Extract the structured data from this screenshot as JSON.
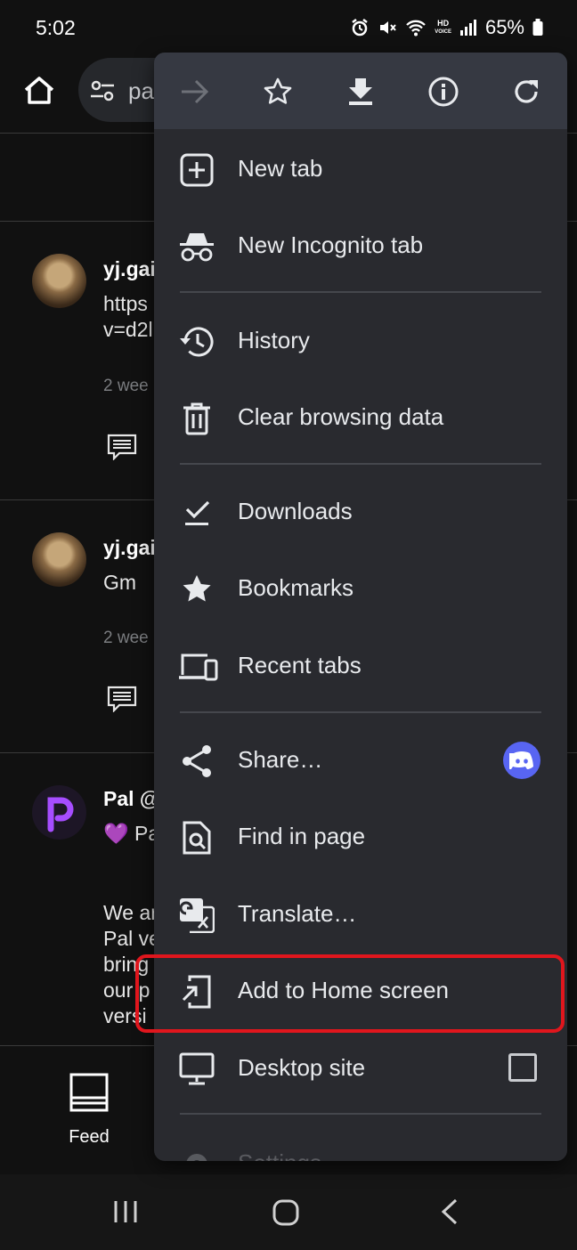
{
  "status_bar": {
    "time": "5:02",
    "network_badge": "HD",
    "network_badge_sub": "VOICE",
    "battery": "65%",
    "icons": [
      "alarm-icon",
      "mute-icon",
      "wifi-icon",
      "signal-icon",
      "battery-icon"
    ]
  },
  "browser": {
    "url_partial": "pa"
  },
  "feed": {
    "posts": [
      {
        "author": "yj.gai",
        "text": "https\nv=d2l",
        "time": "2 wee"
      },
      {
        "author": "yj.gai",
        "text": "Gm",
        "time": "2 wee"
      },
      {
        "author": "Pal @",
        "line1": "💜 Pa",
        "body": "We ar\nPal ve\nbring\nour p\nversi"
      }
    ],
    "bottom_tab": "Feed"
  },
  "menu": {
    "icon_row": [
      "forward-icon",
      "bookmark-star-icon",
      "download-icon",
      "info-icon",
      "reload-icon"
    ],
    "items": [
      {
        "label": "New tab",
        "icon": "new-tab-icon"
      },
      {
        "label": "New Incognito tab",
        "icon": "incognito-icon"
      },
      {
        "label": "History",
        "icon": "history-icon"
      },
      {
        "label": "Clear browsing data",
        "icon": "trash-icon"
      },
      {
        "label": "Downloads",
        "icon": "downloads-icon"
      },
      {
        "label": "Bookmarks",
        "icon": "bookmarks-star-icon"
      },
      {
        "label": "Recent tabs",
        "icon": "devices-icon"
      },
      {
        "label": "Share…",
        "icon": "share-icon"
      },
      {
        "label": "Find in page",
        "icon": "find-in-page-icon"
      },
      {
        "label": "Translate…",
        "icon": "translate-icon"
      },
      {
        "label": "Add to Home screen",
        "icon": "add-to-home-icon"
      },
      {
        "label": "Desktop site",
        "icon": "desktop-icon"
      },
      {
        "label": "Settings",
        "icon": "settings-icon"
      }
    ]
  },
  "colors": {
    "menu_bg": "#292a2f",
    "menu_icon_row_bg": "#363942",
    "highlight": "#e0161d",
    "discord": "#5865f2",
    "pal_purple": "#a64dff"
  }
}
